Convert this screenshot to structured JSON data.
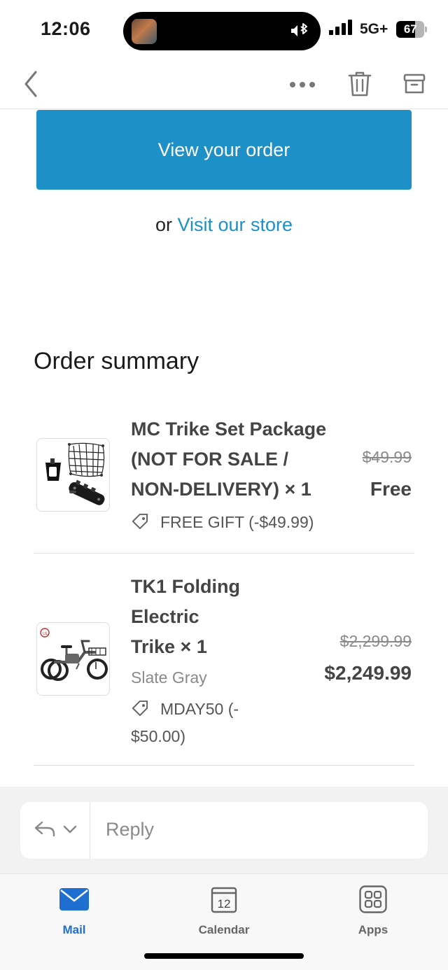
{
  "status": {
    "time": "12:06",
    "network": "5G+",
    "battery": "67",
    "battery_level": 0.67
  },
  "nav": {
    "icons": [
      "chevron-left-icon",
      "more-icon",
      "trash-icon",
      "archive-icon"
    ]
  },
  "email": {
    "view_order_label": "View your order",
    "or_text": "or",
    "visit_store_label": "Visit our store",
    "summary_title": "Order summary",
    "accent_color": "#1e90c8",
    "items": [
      {
        "name_lines": [
          "MC Trike Set Package",
          "(NOT FOR SALE /",
          "NON-DELIVERY) × 1"
        ],
        "variant": "",
        "discount_lines": [
          "FREE GIFT (-$49.99)"
        ],
        "price_old": "$49.99",
        "price_new": "Free"
      },
      {
        "name_lines": [
          "TK1 Folding",
          "Electric",
          "Trike × 1"
        ],
        "variant": "Slate Gray",
        "discount_lines": [
          "MDAY50 (-",
          "$50.00)"
        ],
        "price_old": "$2,299.99",
        "price_new": "$2,249.99"
      }
    ]
  },
  "reply": {
    "label": "Reply"
  },
  "tabs": [
    {
      "label": "Mail",
      "icon": "mail-icon",
      "active": true
    },
    {
      "label": "Calendar",
      "icon": "calendar-icon",
      "day": "12",
      "active": false
    },
    {
      "label": "Apps",
      "icon": "apps-icon",
      "active": false
    }
  ],
  "colors": {
    "active_tab": "#1e6fd0",
    "button": "#1e90c8"
  }
}
